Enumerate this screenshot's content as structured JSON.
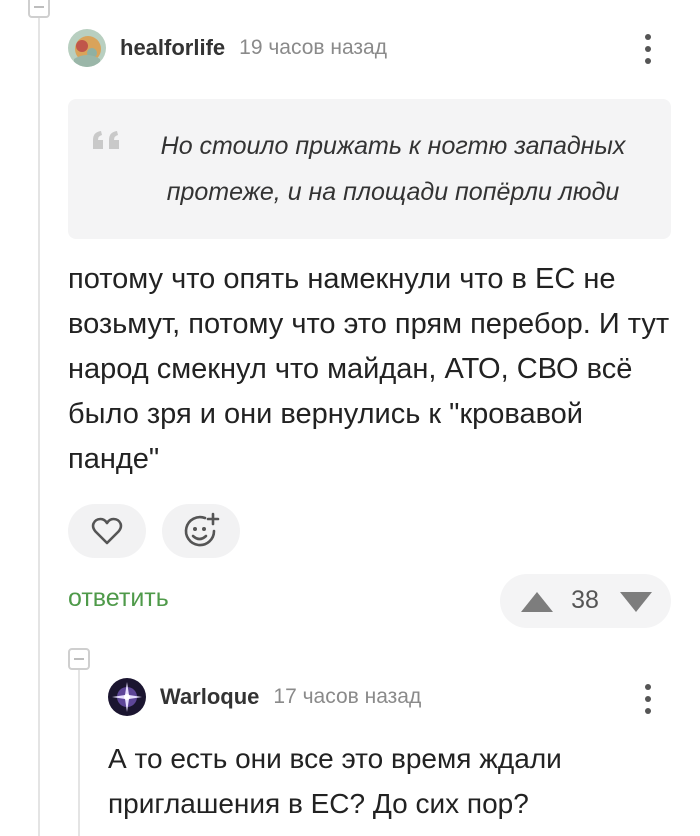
{
  "comment": {
    "author": "healforlife",
    "time": "19 часов назад",
    "quote": "Но стоило прижать к ногтю западных протеже, и на площади попёрли люди",
    "body": "потому что опять намекнули что в ЕС не возьмут, потому что это прям перебор. И тут народ смекнул что майдан, АТО, СВО всё было зря и они вернулись к \"кровавой панде\"",
    "reply_label": "ответить",
    "rating": "38",
    "icons": [
      "heart-icon",
      "add-emoji-icon",
      "upvote-icon",
      "downvote-icon",
      "more-options-icon",
      "quote-mark-icon"
    ]
  },
  "reply": {
    "author": "Warloque",
    "time": "17 часов назад",
    "body": "А то есть они все это время ждали приглашения в ЕС? До сих пор?"
  },
  "colors": {
    "accent": "#4f9a4a",
    "quote_bg": "#f4f4f5",
    "muted": "#8a8a8a"
  }
}
